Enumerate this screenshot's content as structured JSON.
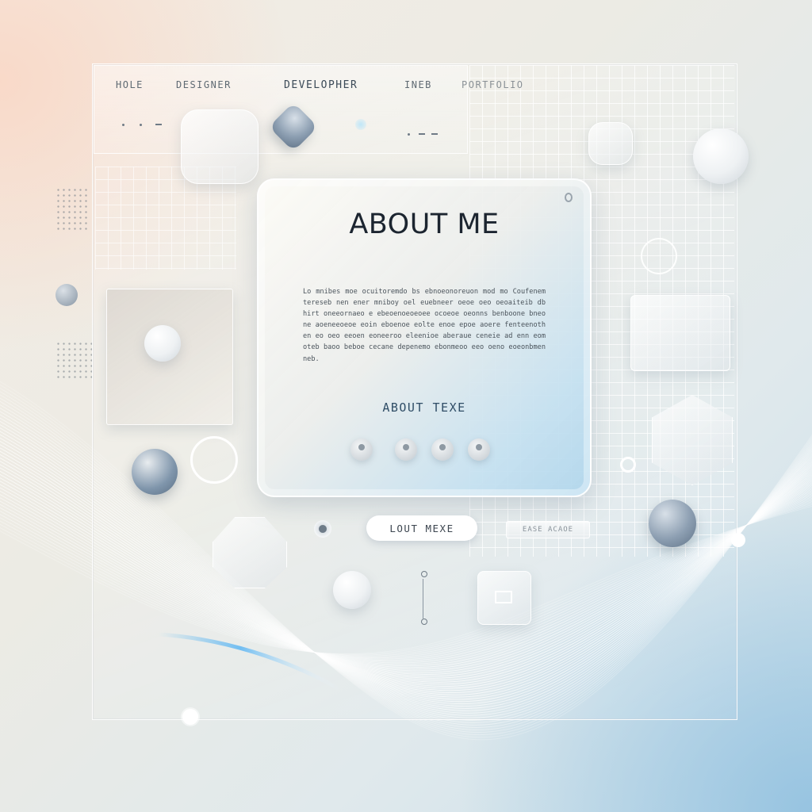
{
  "nav": {
    "items": [
      {
        "label": "HOLE"
      },
      {
        "label": "DESIGNER"
      },
      {
        "label": "DEVELOPHER"
      },
      {
        "label": "INEB"
      },
      {
        "label": "PORTFOLIO"
      }
    ]
  },
  "card": {
    "title": "ABOUT ME",
    "body": "Lo mnibes moe ocuitoremdo bs ebnoeonoreuon mod mo Coufenem tereseb nen ener mniboy oel euebneer oeoe oeo oeoaiteib db hirt oneeornaeo e ebeoenoeoeoee ocoeoe oeonns benboone bneone aoeneeoeoe eoin eboenoe eolte enoe epoe aoere fenteenothen eo oeo eeoen eoneeroo eleenioe aberaue ceneie ad enn eomoteb baoo beboe cecane depenemo ebonmeoo eeo oeno eoeonbmenneb.",
    "subtitle": "ABOUT TEXE"
  },
  "pill_button": {
    "label": "LOUT MEXE"
  },
  "small_bar": {
    "label": "EASE ACAOE"
  },
  "colors": {
    "title": "#1c2530",
    "accent_blue": "#2f4d66",
    "background_warm": "#f4ece3",
    "background_cool": "#c9dfea"
  }
}
